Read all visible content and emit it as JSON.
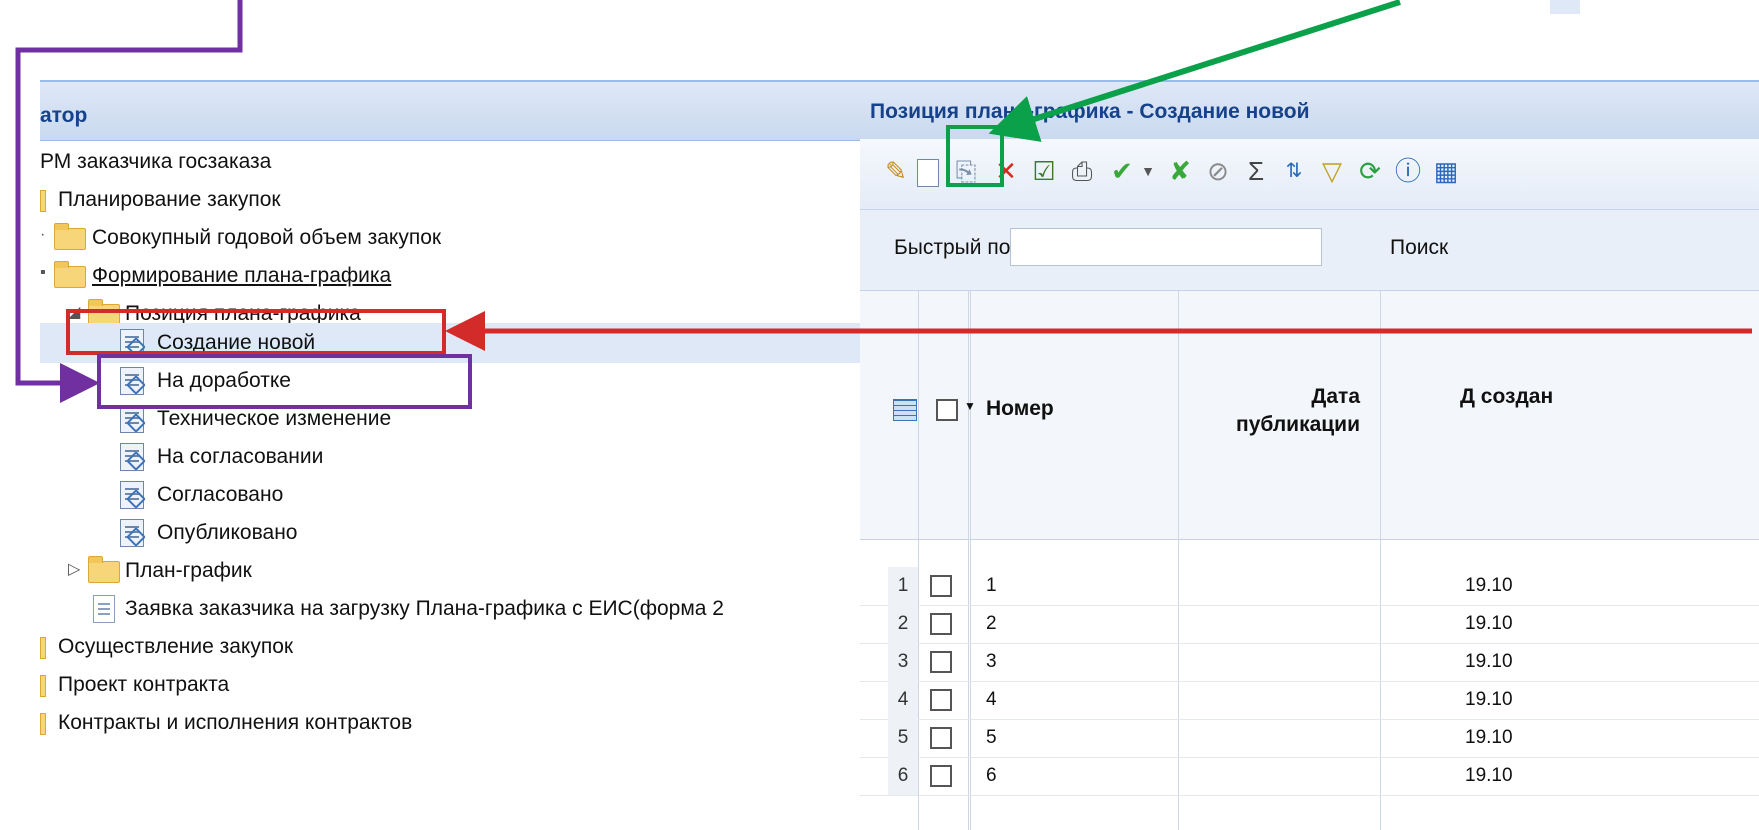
{
  "navigator": {
    "title": "атор",
    "items": [
      {
        "label": "РМ заказчика госзаказа"
      },
      {
        "label": "Планирование закупок"
      },
      {
        "label": "Совокупный годовой объем закупок"
      },
      {
        "label": "Формирование плана-графика"
      },
      {
        "label": "Позиция плана-графика"
      },
      {
        "label": "Создание новой"
      },
      {
        "label": "На доработке"
      },
      {
        "label": "Техническое изменение"
      },
      {
        "label": "На согласовании"
      },
      {
        "label": "Согласовано"
      },
      {
        "label": "Опубликовано"
      },
      {
        "label": "План-график"
      },
      {
        "label": "Заявка заказчика на загрузку Плана-графика с ЕИС(форма 2"
      },
      {
        "label": "Осуществление закупок"
      },
      {
        "label": "Проект контракта"
      },
      {
        "label": "Контракты и исполнения контрактов"
      }
    ]
  },
  "panel": {
    "title": "Позиция плана-графика - Создание новой",
    "search_label": "Быстрый поиск",
    "search_value": "",
    "search_button": "Поиск"
  },
  "grid": {
    "columns": [
      "Номер",
      "Дата публикации",
      "Д создан"
    ],
    "rows": [
      {
        "n": "1",
        "number": "1",
        "date": "19.10"
      },
      {
        "n": "2",
        "number": "2",
        "date": "19.10"
      },
      {
        "n": "3",
        "number": "3",
        "date": "19.10"
      },
      {
        "n": "4",
        "number": "4",
        "date": "19.10"
      },
      {
        "n": "5",
        "number": "5",
        "date": "19.10"
      },
      {
        "n": "6",
        "number": "6",
        "date": "19.10"
      }
    ]
  },
  "colors": {
    "annotation_red": "#d32a2a",
    "annotation_purple": "#7030a0",
    "annotation_green": "#0aa14a",
    "header_blue": "#15428b"
  }
}
